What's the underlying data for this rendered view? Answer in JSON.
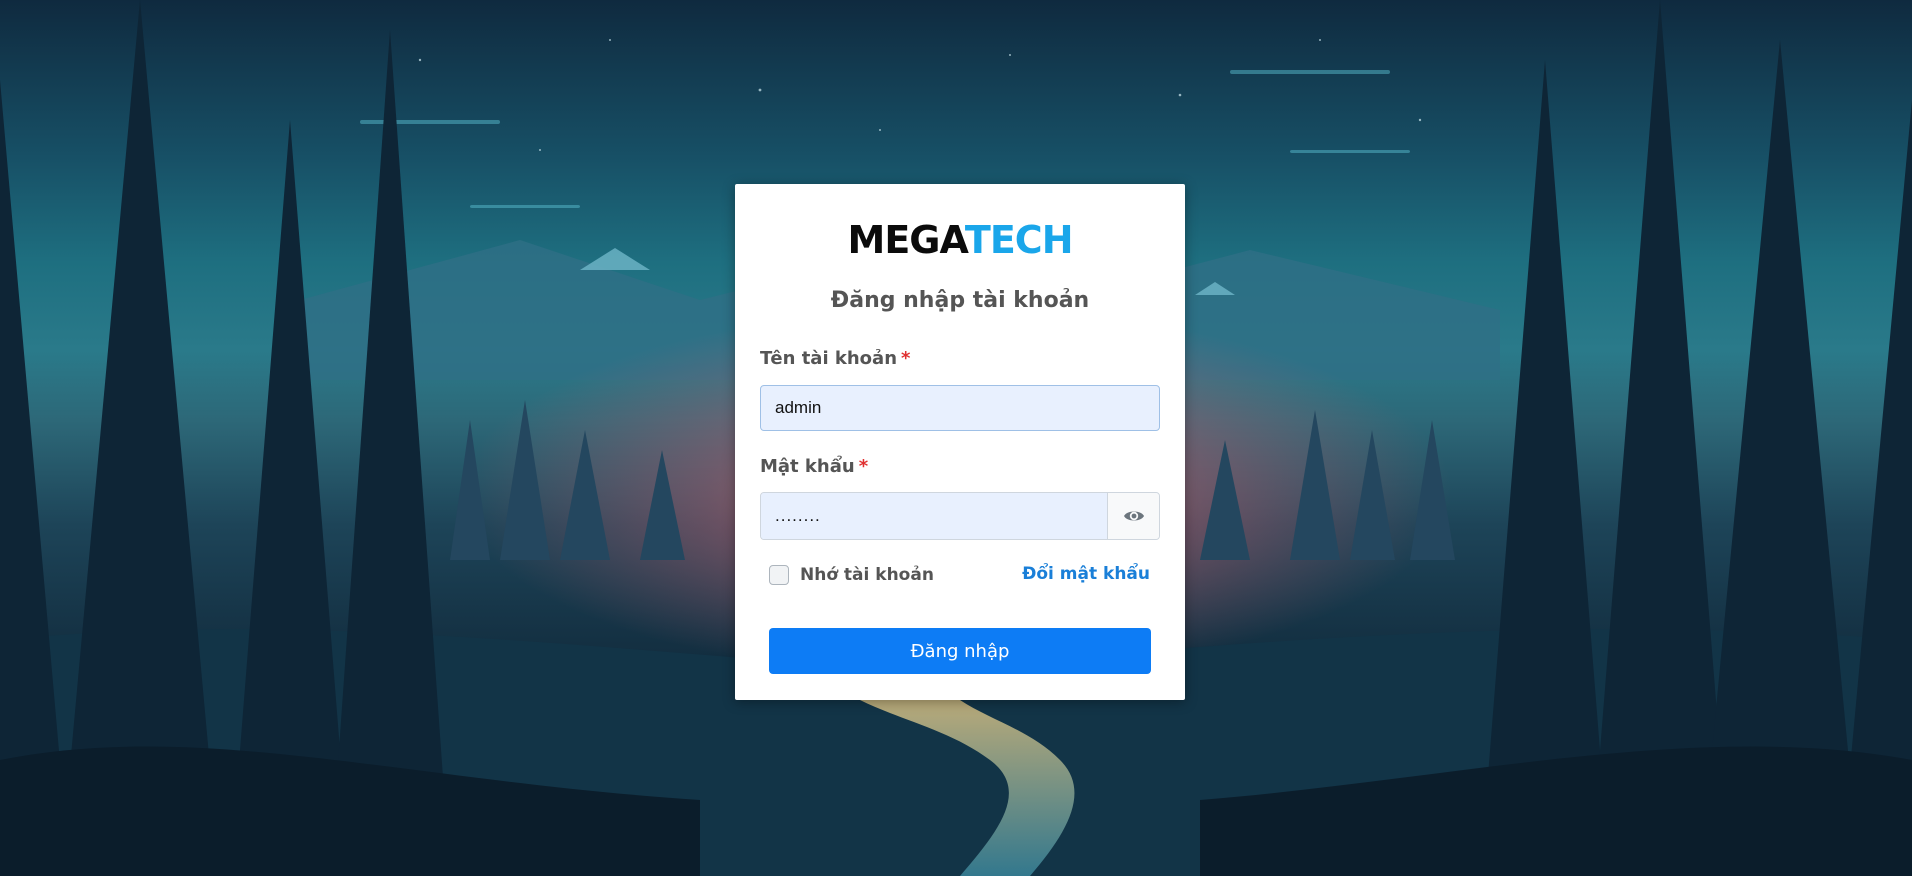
{
  "brand": {
    "part1": "MEGA",
    "part2": "TECH"
  },
  "subtitle": "Đăng nhập tài khoản",
  "username": {
    "label": "Tên tài khoản",
    "required_mark": "*",
    "value": "admin"
  },
  "password": {
    "label": "Mật khẩu",
    "required_mark": "*",
    "value": "........",
    "toggle_icon": "eye-icon"
  },
  "remember": {
    "label": "Nhớ tài khoản",
    "checked": false
  },
  "change_password_link": "Đổi mật khẩu",
  "login_button": "Đăng nhập",
  "colors": {
    "accent": "#0d7cf5",
    "brand_tech": "#1aa6ea",
    "link": "#1a7fd8",
    "required": "#e03131"
  }
}
